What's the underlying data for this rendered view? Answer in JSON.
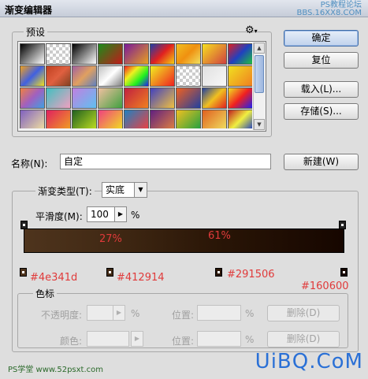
{
  "window": {
    "title": "渐变编辑器",
    "watermark_line1": "PS教程论坛",
    "watermark_line2": "BBS.16XX8.COM"
  },
  "presets": {
    "label": "预设",
    "gear_icon": "gear-icon",
    "swatches": [
      "linear-gradient(135deg,#000,#fff)",
      "repeating-conic-gradient(#ccc 0 25%, #fff 0 50%) 0 0/8px 8px",
      "linear-gradient(135deg,#000,#fff)",
      "linear-gradient(135deg,#1a8c1a,#c21a1a)",
      "linear-gradient(135deg,#7a1a9a,#e8a020)",
      "linear-gradient(135deg,#1e3fa8,#e02020,#f6d010)",
      "linear-gradient(135deg,#f0c020,#f09010,#f0e060)",
      "linear-gradient(135deg,#f7e020,#d04040)",
      "linear-gradient(135deg,#e02020,#2040c0,#20c040)",
      "linear-gradient(135deg,#f0a020,#4060e0,#f0e020)",
      "linear-gradient(135deg,#c04020,#e06040,#804020)",
      "linear-gradient(135deg,#a060a0,#e0a060,#6080c0)",
      "linear-gradient(135deg,#c0c0c0,#fff,#808080)",
      "linear-gradient(135deg,#f02020,#f0f020,#20f020,#2020f0)",
      "linear-gradient(135deg,#f0f020,#f02020)",
      "repeating-conic-gradient(#ccc 0 25%, #fff 0 50%) 0 0/8px 8px",
      "linear-gradient(135deg,#e0e0e0,#f8f8f8)",
      "linear-gradient(135deg,#f0e020,#f08020)",
      "linear-gradient(135deg,#f08040,#a060c0,#40a0e0)",
      "linear-gradient(135deg,#40c0c0,#f0a0c0)",
      "linear-gradient(135deg,#c080e0,#60c0f0)",
      "linear-gradient(135deg,#f0c0a0,#40a040)",
      "linear-gradient(135deg,#c02040,#f08020)",
      "linear-gradient(135deg,#4040c0,#f0c040)",
      "linear-gradient(135deg,#f06020,#2040a0)",
      "linear-gradient(135deg,#2040a0,#f0c020,#e02020)",
      "linear-gradient(135deg,#f0e020,#f02020,#2020f0)",
      "linear-gradient(135deg,#8060c0,#f0e0a0)",
      "linear-gradient(135deg,#e02060,#f0a020)",
      "linear-gradient(135deg,#206020,#c0e020)",
      "linear-gradient(135deg,#f04080,#f0e020)",
      "linear-gradient(135deg,#2080c0,#f04040)",
      "linear-gradient(135deg,#602080,#e08040)",
      "linear-gradient(135deg,#f0c020,#20a040)",
      "linear-gradient(135deg,#e06020,#f0e060)",
      "linear-gradient(135deg,#c02020,#f0f040,#2040c0)"
    ]
  },
  "buttons": {
    "ok": "确定",
    "reset": "复位",
    "load": "载入(L)...",
    "save": "存储(S)...",
    "new": "新建(W)"
  },
  "name_row": {
    "label": "名称(N):",
    "value": "自定"
  },
  "gradient_type": {
    "label": "渐变类型(T):",
    "value": "实底"
  },
  "smoothness": {
    "label": "平滑度(M):",
    "value": "100",
    "unit": "%"
  },
  "gradient_bar": {
    "stops": [
      {
        "color": "#4e341d",
        "location": 0
      },
      {
        "color": "#412914",
        "location": 27
      },
      {
        "color": "#291506",
        "location": 61
      },
      {
        "color": "#160600",
        "location": 100
      }
    ],
    "annotations": {
      "pct_27": "27%",
      "pct_61": "61%",
      "color_1": "#4e341d",
      "color_2": "#412914",
      "color_3": "#291506",
      "color_4": "#160600"
    }
  },
  "color_stops_group": {
    "label": "色标",
    "opacity_label": "不透明度:",
    "opacity_unit": "%",
    "position_label_1": "位置:",
    "position_unit_1": "%",
    "delete_1": "删除(D)",
    "color_label": "颜色:",
    "position_label_2": "位置:",
    "position_unit_2": "%",
    "delete_2": "删除(D)"
  },
  "footer": {
    "logo_left": "PS学堂  www.52psxt.com",
    "logo_right": "UiBQ.CoM"
  }
}
